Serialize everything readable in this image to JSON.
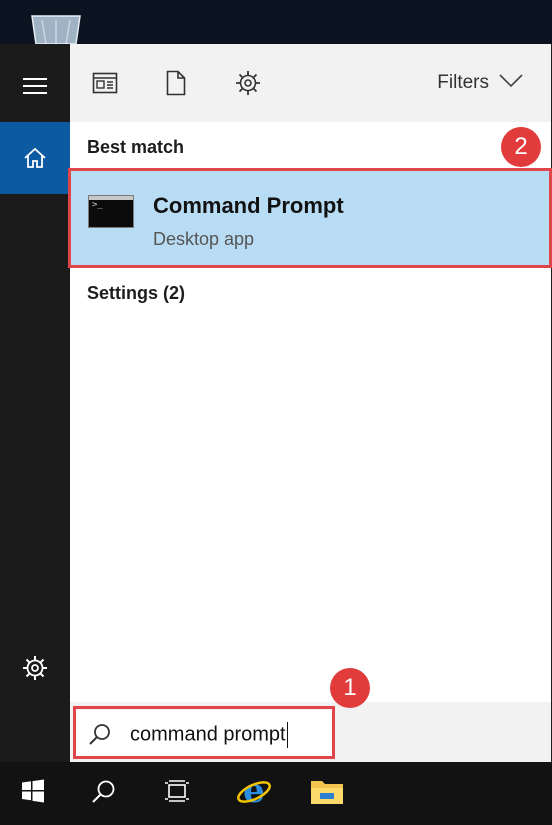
{
  "toolbar": {
    "filters_label": "Filters"
  },
  "results": {
    "best_match_title": "Best match",
    "item": {
      "name": "Command Prompt",
      "subtitle": "Desktop app"
    },
    "settings_title": "Settings (2)"
  },
  "search": {
    "value": "command prompt"
  },
  "annotations": {
    "step1": "1",
    "step2": "2"
  },
  "icons": {
    "rail": [
      "hamburger-icon",
      "home-icon",
      "settings-icon"
    ],
    "toolbar": [
      "apps-icon",
      "documents-icon",
      "settings-icon"
    ],
    "taskbar": [
      "windows-start-icon",
      "search-icon",
      "task-view-icon",
      "internet-explorer-icon",
      "file-explorer-icon"
    ]
  },
  "colors": {
    "accent_blue": "#0c5aa1",
    "selection": "#b9dcf5",
    "annotation_red": "#e0454a"
  }
}
